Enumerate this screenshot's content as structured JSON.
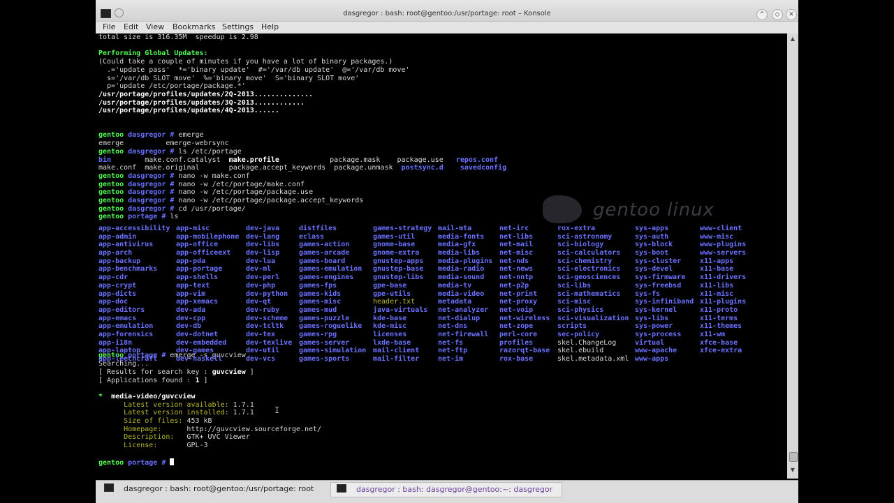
{
  "window": {
    "title": "dasgregor : bash: root@gentoo:/usr/portage: root – Konsole",
    "minimize": "^",
    "maximize": "◇",
    "close": "✕"
  },
  "menu": [
    "File",
    "Edit",
    "View",
    "Bookmarks",
    "Settings",
    "Help"
  ],
  "watermark": "gentoo linux",
  "tabs": [
    {
      "label": "dasgregor : bash: root@gentoo:/usr/portage: root"
    },
    {
      "label": "dasgregor : bash: dasgregor@gentoo:~: dasgregor"
    }
  ],
  "terminal": {
    "line_total": "total size is 316.35M  speedup is 2.98",
    "updates_header": "Performing Global Updates:",
    "updates_note": "(Could take a couple of minutes if you have a lot of binary packages.)",
    "legend1": "  .='update pass'  *='binary update'  #='/var/db update'  @='/var/db move'",
    "legend2": "  s='/var/db SLOT move'  %='binary move'  S='binary SLOT move'",
    "legend3": "  p='update /etc/portage/package.*'",
    "upd1": "/usr/portage/profiles/updates/2Q-2013..............",
    "upd2": "/usr/portage/profiles/updates/3Q-2013............",
    "upd3": "/usr/portage/profiles/updates/4Q-2013......",
    "prompt_host": "gentoo",
    "prompt_user_dir": "dasgregor",
    "prompt_portage_dir": "portage",
    "prompt_hash": "#",
    "cmd1": " emerge",
    "out_emerge": "emerge          emerge-webrsync",
    "cmd2": " ls /etc/portage",
    "etc_row1_bin": "bin",
    "etc_row1_catalyst": "make.conf.catalyst",
    "etc_row1_profile": "make.profile",
    "etc_row1_mask": "package.mask",
    "etc_row1_use": "package.use",
    "etc_row1_repos": "repos.conf",
    "etc_row2_makeconf": "make.conf",
    "etc_row2_original": "make.original",
    "etc_row2_accept": "package.accept_keywords",
    "etc_row2_unmask": "package.unmask",
    "etc_row2_postsync": "postsync.d",
    "etc_row2_savedconfig": "savedconfig",
    "cmd3": " nano -w make.conf",
    "cmd4": " nano -w /etc/portage/make.conf",
    "cmd5": " nano -w /etc/portage/package.use",
    "cmd6": " nano -w /etc/portage/package.accept_keywords",
    "cmd7": " cd /usr/portage/",
    "cmd8": " ls",
    "cmd9": " emerge -s guvcview",
    "searching": "Searching...",
    "results_prefix": "[ Results for search key : ",
    "results_key": "guvcview",
    "results_suffix": " ]",
    "apps_prefix": "[ Applications found : ",
    "apps_count": "1",
    "apps_suffix": " ]",
    "pkg_star": "*",
    "pkg_name": "  media-video/guvcview",
    "lbl_latest": "      Latest version available:",
    "val_latest": " 1.7.1",
    "lbl_installed": "      Latest version installed:",
    "val_installed": " 1.7.1",
    "lbl_size": "      Size of files:",
    "val_size": " 453 kB",
    "lbl_home": "      Homepage:",
    "val_home": "      http://guvcview.sourceforge.net/",
    "lbl_desc": "      Description:",
    "val_desc": "   GTK+ UVC Viewer",
    "lbl_license": "      License:",
    "val_license": "       GPL-3"
  },
  "portage_listing": [
    [
      "app-accessibility",
      "app-admin",
      "app-antivirus",
      "app-arch",
      "app-backup",
      "app-benchmarks",
      "app-cdr",
      "app-crypt",
      "app-dicts",
      "app-doc",
      "app-editors",
      "app-emacs",
      "app-emulation",
      "app-forensics",
      "app-i18n",
      "app-laptop",
      "app-leechcraft"
    ],
    [
      "app-misc",
      "app-mobilephone",
      "app-office",
      "app-officeext",
      "app-pda",
      "app-portage",
      "app-shells",
      "app-text",
      "app-vim",
      "app-xemacs",
      "dev-ada",
      "dev-cpp",
      "dev-db",
      "dev-dotnet",
      "dev-embedded",
      "dev-games",
      "dev-haskell"
    ],
    [
      "dev-java",
      "dev-lang",
      "dev-libs",
      "dev-lisp",
      "dev-lua",
      "dev-ml",
      "dev-perl",
      "dev-php",
      "dev-python",
      "dev-qt",
      "dev-ruby",
      "dev-scheme",
      "dev-tcltk",
      "dev-tex",
      "dev-texlive",
      "dev-util",
      "dev-vcs"
    ],
    [
      "distfiles",
      "eclass",
      "games-action",
      "games-arcade",
      "games-board",
      "games-emulation",
      "games-engines",
      "games-fps",
      "games-kids",
      "games-misc",
      "games-mud",
      "games-puzzle",
      "games-roguelike",
      "games-rpg",
      "games-server",
      "games-simulation",
      "games-sports"
    ],
    [
      "games-strategy",
      "games-util",
      "gnome-base",
      "gnome-extra",
      "gnustep-apps",
      "gnustep-base",
      "gnustep-libs",
      "gpe-base",
      "gpe-utils",
      "header.txt",
      "java-virtuals",
      "kde-base",
      "kde-misc",
      "licenses",
      "lxde-base",
      "mail-client",
      "mail-filter"
    ],
    [
      "mail-mta",
      "media-fonts",
      "media-gfx",
      "media-libs",
      "media-plugins",
      "media-radio",
      "media-sound",
      "media-tv",
      "media-video",
      "metadata",
      "net-analyzer",
      "net-dialup",
      "net-dns",
      "net-firewall",
      "net-fs",
      "net-ftp",
      "net-im"
    ],
    [
      "net-irc",
      "net-libs",
      "net-mail",
      "net-misc",
      "net-nds",
      "net-news",
      "net-nntp",
      "net-p2p",
      "net-print",
      "net-proxy",
      "net-voip",
      "net-wireless",
      "net-zope",
      "perl-core",
      "profiles",
      "razorqt-base",
      "rox-base"
    ],
    [
      "rox-extra",
      "sci-astronomy",
      "sci-biology",
      "sci-calculators",
      "sci-chemistry",
      "sci-electronics",
      "sci-geosciences",
      "sci-libs",
      "sci-mathematics",
      "sci-misc",
      "sci-physics",
      "sci-visualization",
      "scripts",
      "sec-policy",
      "skel.ChangeLog",
      "skel.ebuild",
      "skel.metadata.xml"
    ],
    [
      "sys-apps",
      "sys-auth",
      "sys-block",
      "sys-boot",
      "sys-cluster",
      "sys-devel",
      "sys-firmware",
      "sys-freebsd",
      "sys-fs",
      "sys-infiniband",
      "sys-kernel",
      "sys-libs",
      "sys-power",
      "sys-process",
      "virtual",
      "www-apache",
      "www-apps"
    ],
    [
      "www-client",
      "www-misc",
      "www-plugins",
      "www-servers",
      "x11-apps",
      "x11-base",
      "x11-drivers",
      "x11-libs",
      "x11-misc",
      "x11-plugins",
      "x11-proto",
      "x11-terms",
      "x11-themes",
      "x11-wm",
      "xfce-base",
      "xfce-extra"
    ]
  ]
}
